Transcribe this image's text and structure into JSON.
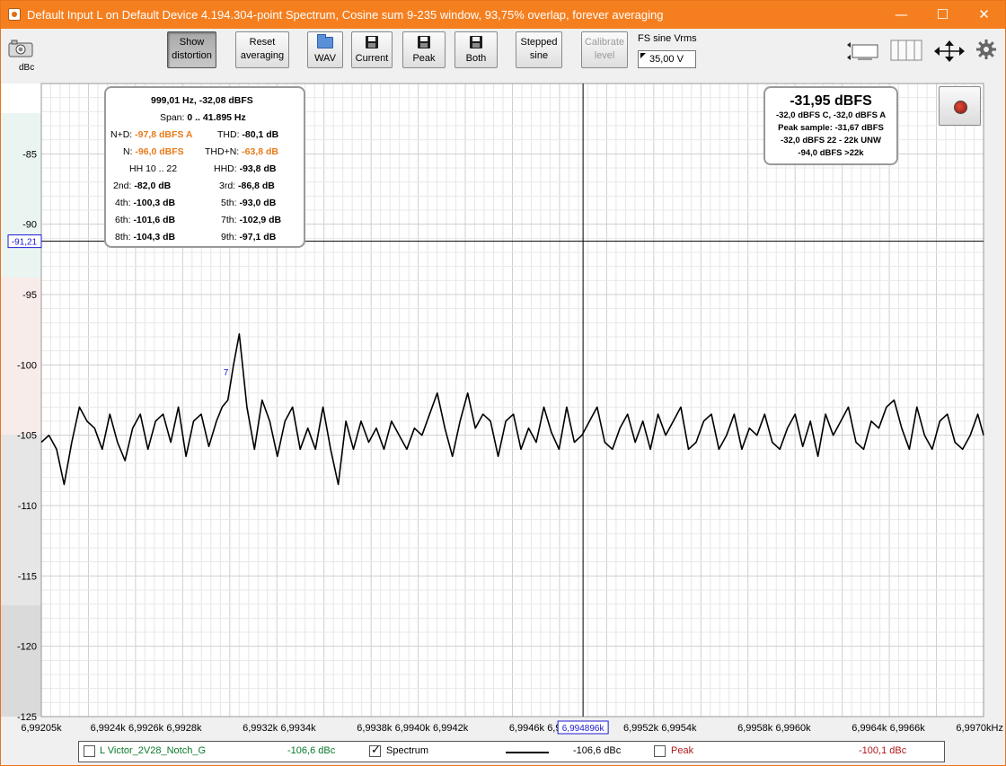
{
  "window": {
    "title": "Default Input L on Default Device 4.194.304-point Spectrum, Cosine sum 9-235 window, 93,75% overlap, forever averaging",
    "minimize_glyph": "—",
    "maximize_glyph": "☐",
    "close_glyph": "✕"
  },
  "toolbar": {
    "show_distortion": [
      "Show",
      "distortion"
    ],
    "reset_averaging": [
      "Reset",
      "averaging"
    ],
    "wav_label": "WAV",
    "current_label": "Current",
    "peak_label": "Peak",
    "both_label": "Both",
    "stepped_sine": [
      "Stepped",
      "sine"
    ],
    "calibrate_level": [
      "Calibrate",
      "level"
    ],
    "fs_label": "FS sine Vrms",
    "fs_value": "35,00 V"
  },
  "icons": [
    "camera-icon",
    "folder-icon",
    "floppy-icon",
    "rec-icon",
    "zoom-fit-icon",
    "columns-icon",
    "arrows-icon",
    "gear-icon"
  ],
  "colors": {
    "titlebar": "#f57f1f",
    "trace": "#000000",
    "cursor": "#1a1ad1",
    "orange_value": "#e87b1a",
    "legend_green": "#0a7a2a",
    "legend_red": "#b01818"
  },
  "chart": {
    "unit_label": "dBc",
    "cursor_y_label": "-91,21",
    "cursor_x_label": "6,994896k",
    "marker_label": "7"
  },
  "distortion": {
    "header": "999,01 Hz, -32,08 dBFS",
    "span": {
      "label": "Span:",
      "value": "0 .. 41.895 Hz"
    },
    "nd": {
      "label": "N+D:",
      "value": "-97,8 dBFS A"
    },
    "thd": {
      "label": "THD:",
      "value": "-80,1 dB"
    },
    "n": {
      "label": "N:",
      "value": "-96,0 dBFS"
    },
    "thdn": {
      "label": "THD+N:",
      "value": "-63,8 dB"
    },
    "hh": "HH 10 .. 22",
    "hhd": {
      "label": "HHD:",
      "value": "-93,8 dB"
    },
    "h2": {
      "label": "2nd:",
      "value": "-82,0 dB"
    },
    "h3": {
      "label": "3rd:",
      "value": "-86,8 dB"
    },
    "h4": {
      "label": "4th:",
      "value": "-100,3 dB"
    },
    "h5": {
      "label": "5th:",
      "value": "-93,0 dB"
    },
    "h6": {
      "label": "6th:",
      "value": "-101,6 dB"
    },
    "h7": {
      "label": "7th:",
      "value": "-102,9 dB"
    },
    "h8": {
      "label": "8th:",
      "value": "-104,3 dB"
    },
    "h9": {
      "label": "9th:",
      "value": "-97,1 dB"
    }
  },
  "level": {
    "main": "-31,95 dBFS",
    "line1": "-32,0 dBFS C, -32,0 dBFS A",
    "line2": "Peak sample: -31,67 dBFS",
    "line3": "-32,0 dBFS 22 - 22k UNW",
    "line4": "-94,0 dBFS >22k"
  },
  "legend": {
    "item1": {
      "name": "L Victor_2V28_Notch_G",
      "value": "-106,6 dBc",
      "checked": false
    },
    "item2": {
      "name": "Spectrum",
      "value": "-106,6 dBc",
      "checked": true
    },
    "item3": {
      "name": "Peak",
      "value": "-100,1 dBc",
      "checked": false
    }
  },
  "chart_data": {
    "type": "line",
    "xlabel": "",
    "ylabel": "dBc",
    "ylim": [
      -125,
      -80
    ],
    "xlim": [
      6992.05,
      6997.0
    ],
    "yticks": [
      -85,
      -90,
      -95,
      -100,
      -105,
      -110,
      -115,
      -120,
      -125
    ],
    "xtick_labels": [
      "6,99205k",
      "6,9924k",
      "6,9926k",
      "6,9928k",
      "6,9932k",
      "6,9934k",
      "6,9938k",
      "6,9940k",
      "6,9942k",
      "6,9946k",
      "6,9948k",
      "6,9952k",
      "6,9954k",
      "6,9958k",
      "6,9960k",
      "6,9964k",
      "6,9966k",
      "6,9970kHz"
    ],
    "xtick_values": [
      6992.05,
      6992.4,
      6992.6,
      6992.8,
      6993.2,
      6993.4,
      6993.8,
      6994.0,
      6994.2,
      6994.6,
      6994.8,
      6995.2,
      6995.4,
      6995.8,
      6996.0,
      6996.4,
      6996.6,
      6997.0
    ],
    "cursor": {
      "x": 6994.896,
      "y": -91.21
    },
    "marker": {
      "x": 6993.02,
      "y": -100.5
    },
    "series": [
      {
        "x": [
          6992.05,
          6992.09,
          6992.13,
          6992.17,
          6992.21,
          6992.25,
          6992.29,
          6992.33,
          6992.37,
          6992.41,
          6992.45,
          6992.49,
          6992.53,
          6992.57,
          6992.61,
          6992.65,
          6992.69,
          6992.73,
          6992.77,
          6992.81,
          6992.85,
          6992.89,
          6992.93,
          6992.97,
          6993.0,
          6993.03,
          6993.06,
          6993.09,
          6993.13,
          6993.17,
          6993.21,
          6993.25,
          6993.29,
          6993.33,
          6993.37,
          6993.41,
          6993.45,
          6993.49,
          6993.53,
          6993.57,
          6993.61,
          6993.65,
          6993.69,
          6993.73,
          6993.77,
          6993.81,
          6993.85,
          6993.89,
          6993.93,
          6993.97,
          6994.01,
          6994.05,
          6994.09,
          6994.13,
          6994.17,
          6994.21,
          6994.25,
          6994.29,
          6994.33,
          6994.37,
          6994.41,
          6994.45,
          6994.49,
          6994.53,
          6994.57,
          6994.61,
          6994.65,
          6994.69,
          6994.73,
          6994.77,
          6994.81,
          6994.85,
          6994.89,
          6994.93,
          6994.97,
          6995.01,
          6995.05,
          6995.09,
          6995.13,
          6995.17,
          6995.21,
          6995.25,
          6995.29,
          6995.33,
          6995.37,
          6995.41,
          6995.45,
          6995.49,
          6995.53,
          6995.57,
          6995.61,
          6995.65,
          6995.69,
          6995.73,
          6995.77,
          6995.81,
          6995.85,
          6995.89,
          6995.93,
          6995.97,
          6996.01,
          6996.05,
          6996.09,
          6996.13,
          6996.17,
          6996.21,
          6996.25,
          6996.29,
          6996.33,
          6996.37,
          6996.41,
          6996.45,
          6996.49,
          6996.53,
          6996.57,
          6996.61,
          6996.65,
          6996.69,
          6996.73,
          6996.77,
          6996.81,
          6996.85,
          6996.89,
          6996.93,
          6996.97,
          6997.0
        ],
        "y": [
          -105.5,
          -105.0,
          -106.0,
          -108.5,
          -105.5,
          -103.0,
          -104.0,
          -104.5,
          -106.0,
          -103.5,
          -105.5,
          -106.8,
          -104.5,
          -103.5,
          -106.0,
          -104.0,
          -103.5,
          -105.5,
          -103.0,
          -106.5,
          -104.0,
          -103.5,
          -105.8,
          -104.0,
          -103.0,
          -102.5,
          -100.0,
          -97.8,
          -103.0,
          -106.0,
          -102.5,
          -104.0,
          -106.5,
          -104.0,
          -103.0,
          -106.0,
          -104.5,
          -106.0,
          -103.0,
          -106.0,
          -108.5,
          -104.0,
          -106.0,
          -104.0,
          -105.5,
          -104.5,
          -106.0,
          -104.0,
          -105.0,
          -106.0,
          -104.5,
          -105.0,
          -103.5,
          -102.0,
          -104.5,
          -106.5,
          -104.0,
          -102.0,
          -104.5,
          -103.5,
          -104.0,
          -106.5,
          -104.0,
          -103.5,
          -106.0,
          -104.5,
          -105.5,
          -103.0,
          -104.8,
          -106.0,
          -103.0,
          -105.5,
          -105.0,
          -104.0,
          -103.0,
          -105.5,
          -106.0,
          -104.5,
          -103.5,
          -105.5,
          -104.0,
          -106.0,
          -103.5,
          -105.0,
          -104.0,
          -103.0,
          -106.0,
          -105.5,
          -104.0,
          -103.5,
          -106.0,
          -105.0,
          -103.5,
          -106.0,
          -104.5,
          -105.0,
          -103.5,
          -105.5,
          -106.0,
          -104.5,
          -103.5,
          -105.8,
          -104.0,
          -106.5,
          -103.5,
          -105.0,
          -104.0,
          -103.0,
          -105.5,
          -106.0,
          -104.0,
          -104.5,
          -103.0,
          -102.5,
          -104.5,
          -106.0,
          -103.0,
          -105.0,
          -106.0,
          -104.0,
          -103.5,
          -105.5,
          -106.0,
          -105.0,
          -103.5,
          -105.0
        ]
      }
    ]
  }
}
